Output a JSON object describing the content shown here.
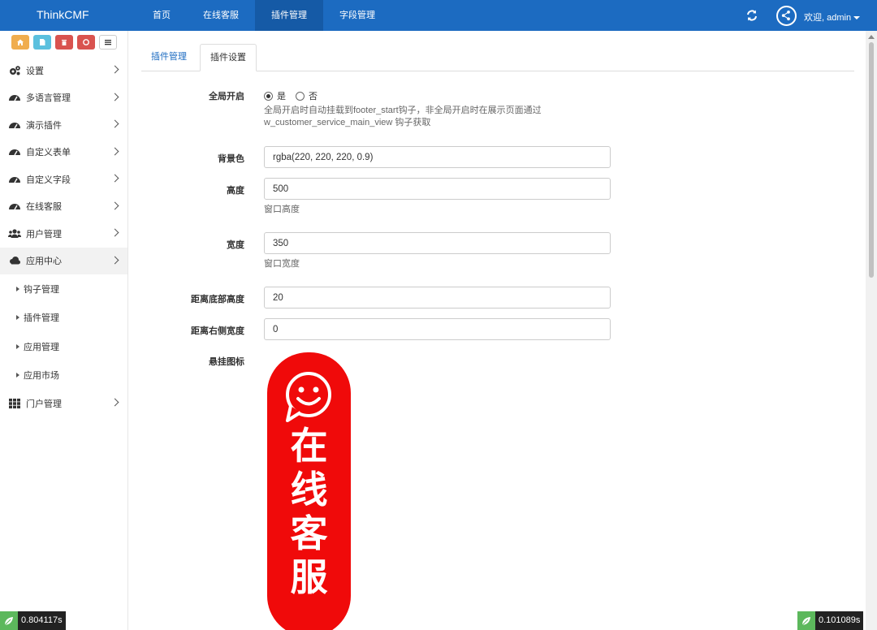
{
  "app": {
    "brand": "ThinkCMF"
  },
  "topnav": {
    "items": [
      "首页",
      "在线客服",
      "插件管理",
      "字段管理"
    ],
    "active_index": 2,
    "user_greeting": "欢迎, admin"
  },
  "sidebar": {
    "shortcuts": [
      "home-icon",
      "file-icon",
      "trash-icon",
      "recycle-icon",
      "list-icon"
    ],
    "menu": [
      {
        "label": "设置",
        "icon": "gears-icon"
      },
      {
        "label": "多语言管理",
        "icon": "dashboard-icon"
      },
      {
        "label": "演示插件",
        "icon": "dashboard-icon"
      },
      {
        "label": "自定义表单",
        "icon": "dashboard-icon"
      },
      {
        "label": "自定义字段",
        "icon": "dashboard-icon"
      },
      {
        "label": "在线客服",
        "icon": "dashboard-icon"
      },
      {
        "label": "用户管理",
        "icon": "users-icon"
      },
      {
        "label": "应用中心",
        "icon": "cloud-icon"
      }
    ],
    "submenu": [
      {
        "label": "钩子管理"
      },
      {
        "label": "插件管理"
      },
      {
        "label": "应用管理"
      },
      {
        "label": "应用市场"
      }
    ],
    "last_menu": {
      "label": "门户管理",
      "icon": "grid-icon"
    }
  },
  "tabs": {
    "plugin_manage": "插件管理",
    "plugin_settings": "插件设置"
  },
  "form": {
    "global_enable": {
      "label": "全局开启",
      "option_yes": "是",
      "option_no": "否",
      "selected": "是",
      "help_line1": "全局开启时自动挂载到footer_start钩子，非全局开启时在展示页面通过",
      "help_line2": "w_customer_service_main_view 钩子获取"
    },
    "background": {
      "label": "背景色",
      "value": "rgba(220, 220, 220, 0.9)"
    },
    "height": {
      "label": "高度",
      "value": "500",
      "help": "窗口高度"
    },
    "width": {
      "label": "宽度",
      "value": "350",
      "help": "窗口宽度"
    },
    "bottom_distance": {
      "label": "距离底部高度",
      "value": "20"
    },
    "right_distance": {
      "label": "距离右侧宽度",
      "value": "0"
    },
    "hang_icon": {
      "label": "悬挂图标",
      "image_text": [
        "在",
        "线",
        "客",
        "服"
      ]
    }
  },
  "debug": {
    "left_time": "0.804117s",
    "right_time": "0.101089s"
  },
  "colors": {
    "navbar": "#1c6bc1",
    "hang_icon_bg": "#f00a0a"
  }
}
